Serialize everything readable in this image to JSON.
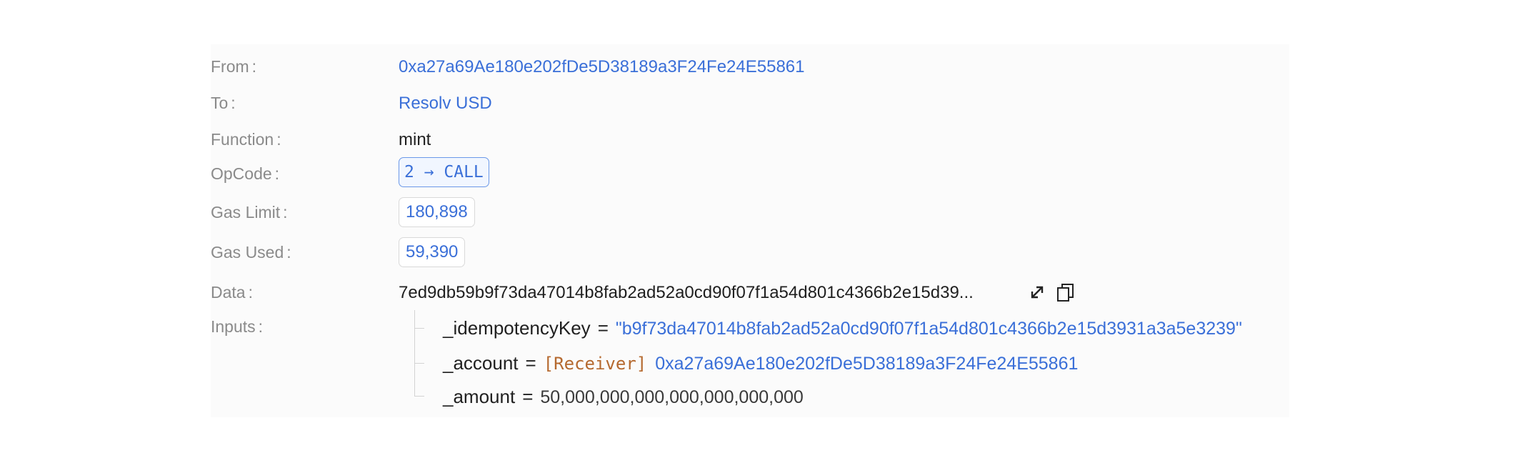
{
  "rows": {
    "from": {
      "label": "From",
      "colon": ":",
      "value": "0xa27a69Ae180e202fDe5D38189a3F24Fe24E55861"
    },
    "to": {
      "label": "To",
      "colon": ":",
      "value": "Resolv USD"
    },
    "function": {
      "label": "Function",
      "colon": ":",
      "value": "mint"
    },
    "opcode": {
      "label": "OpCode",
      "colon": ":",
      "value": "2 → CALL"
    },
    "gas_limit": {
      "label": "Gas Limit",
      "colon": ":",
      "value": "180,898"
    },
    "gas_used": {
      "label": "Gas Used",
      "colon": ":",
      "value": "59,390"
    },
    "data": {
      "label": "Data",
      "colon": ":",
      "value": "7ed9db59b9f73da47014b8fab2ad52a0cd90f07f1a54d801c4366b2e15d39..."
    },
    "inputs": {
      "label": "Inputs",
      "colon": ":"
    }
  },
  "inputs": [
    {
      "name": "_idempotencyKey",
      "eq": "=",
      "value": "\"b9f73da47014b8fab2ad52a0cd90f07f1a54d801c4366b2e15d3931a3a5e3239\""
    },
    {
      "name": "_account",
      "eq": "=",
      "tag": "[Receiver]",
      "value": "0xa27a69Ae180e202fDe5D38189a3F24Fe24E55861"
    },
    {
      "name": "_amount",
      "eq": "=",
      "value": "50,000,000,000,000,000,000,000"
    }
  ],
  "icons": {
    "expand": "expand-icon",
    "copy": "copy-icon"
  },
  "colors": {
    "link": "#3a6fd8",
    "tag": "#b5692f",
    "label": "#8a8a8a"
  }
}
